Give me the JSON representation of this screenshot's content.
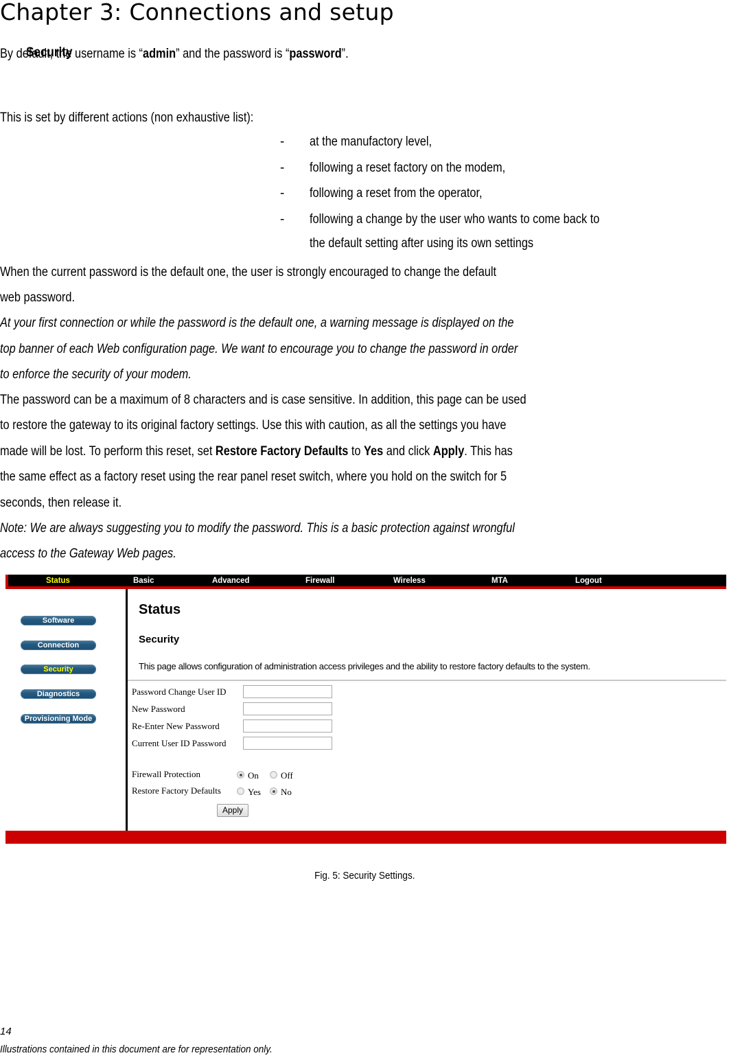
{
  "document": {
    "chapter_title": "Chapter 3: Connections and setup",
    "section_title": "Security",
    "paragraph1": {
      "prefix": "By default, the username is “",
      "username": "admin",
      "middle": "” and the password is “",
      "password": "password",
      "suffix": "”."
    },
    "list_intro": "This is set by different actions (non exhaustive list):",
    "bullets": [
      "at the manufactory level,",
      "following a reset factory on the modem,",
      "following a reset from the operator,",
      "following a change by the user who wants to come back to",
      "the default setting after using its own settings"
    ],
    "bullet_dash": "-",
    "paragraph2": [
      "When the current password is the default one, the user is strongly encouraged to change the default",
      "web password."
    ],
    "italic_paragraph": [
      "At your first connection or while the password is the default one, a warning message is displayed on the",
      "top banner of each Web configuration page. We want to encourage you to change the password in order",
      "to enforce the security of your modem."
    ],
    "paragraph3": {
      "line1": "The password can be a maximum of 8 characters and is case sensitive. In addition, this page can be used",
      "line2": "to restore the gateway to its original factory settings. Use this with caution, as all the settings you have",
      "line3_a": "made will be lost. To perform this reset, set ",
      "line3_b": "Restore Factory Defaults",
      "line3_c": " to ",
      "line3_d": "Yes",
      "line3_e": " and click ",
      "line3_f": "Apply",
      "line3_g": ". This has",
      "line4": "the same effect as a factory reset using the rear panel reset switch, where you hold on the switch for 5",
      "line5": "seconds, then release it."
    },
    "note": [
      "Note: We are always suggesting you to modify the password. This is a basic protection against wrongful",
      "access to the Gateway Web pages."
    ],
    "caption": "Fig. 5: Security Settings.",
    "page_number": "14",
    "footer": "Illustrations contained in this document are for representation only."
  },
  "router_ui": {
    "colors": {
      "nav_bg": "#000000",
      "nav_accent": "#cc0000",
      "active": "#ffff00",
      "side_button": "#245a80"
    },
    "top_nav": [
      {
        "label": "Status",
        "active": true
      },
      {
        "label": "Basic",
        "active": false
      },
      {
        "label": "Advanced",
        "active": false
      },
      {
        "label": "Firewall",
        "active": false
      },
      {
        "label": "Wireless",
        "active": false
      },
      {
        "label": "MTA",
        "active": false
      },
      {
        "label": "Logout",
        "active": false
      }
    ],
    "side_nav": [
      {
        "label": "Software",
        "active": false
      },
      {
        "label": "Connection",
        "active": false
      },
      {
        "label": "Security",
        "active": true
      },
      {
        "label": "Diagnostics",
        "active": false
      },
      {
        "label": "Provisioning Mode",
        "active": false
      }
    ],
    "page_heading": "Status",
    "section_heading": "Security",
    "description": "This page allows configuration of administration access privileges and the ability to restore factory defaults to the system.",
    "fields": [
      {
        "label": "Password Change User ID",
        "value": ""
      },
      {
        "label": "New Password",
        "value": ""
      },
      {
        "label": "Re-Enter New Password",
        "value": ""
      },
      {
        "label": "Current User ID Password",
        "value": ""
      }
    ],
    "firewall_protection": {
      "label": "Firewall Protection",
      "options": [
        "On",
        "Off"
      ],
      "selected": "On"
    },
    "restore_factory_defaults": {
      "label": "Restore Factory Defaults",
      "options": [
        "Yes",
        "No"
      ],
      "selected": "No"
    },
    "apply_label": "Apply"
  }
}
